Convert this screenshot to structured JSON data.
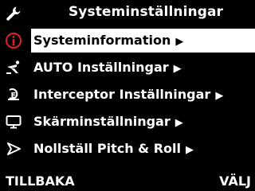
{
  "header": {
    "title": "Systeminställningar",
    "icon": "wrench-icon"
  },
  "menu": {
    "items": [
      {
        "label": "Systeminformation",
        "icon": "info-icon",
        "arrow": "▶",
        "selected": true
      },
      {
        "label": "AUTO Inställningar",
        "icon": "auto-settings-icon",
        "arrow": "▶",
        "selected": false
      },
      {
        "label": "Interceptor Inställningar",
        "icon": "interceptor-icon",
        "arrow": "▶",
        "selected": false
      },
      {
        "label": "Skärminställningar",
        "icon": "monitor-icon",
        "arrow": "▶",
        "selected": false
      },
      {
        "label": "Nollställ Pitch & Roll",
        "icon": "pitch-roll-icon",
        "arrow": "▶",
        "selected": false
      }
    ]
  },
  "footer": {
    "back_label": "TILLBAKA",
    "select_label": "VÄLJ"
  },
  "colors": {
    "background": "#000000",
    "text": "#ffffff",
    "selection": "#ffffff",
    "info_icon": "#e02020"
  }
}
